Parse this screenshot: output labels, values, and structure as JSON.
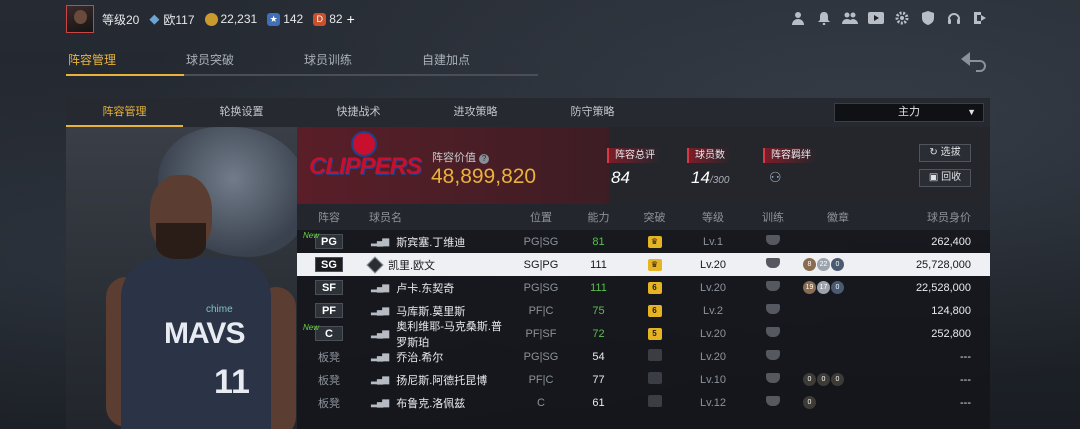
{
  "topbar": {
    "level": "等级20",
    "ou_label": "欧117",
    "coins": "22,231",
    "stars": "142",
    "tickets": "82",
    "plus": "+"
  },
  "main_tabs": [
    "阵容管理",
    "球员突破",
    "球员训练",
    "自建加点"
  ],
  "sub_tabs": [
    "阵容管理",
    "轮换设置",
    "快捷战术",
    "进攻策略",
    "防守策略"
  ],
  "dropdown": {
    "selected": "主力",
    "caret": "▼"
  },
  "team": {
    "logo_text": "CLIPPERS",
    "value_label": "阵容价值",
    "value": "48,899,820",
    "overall_label": "阵容总评",
    "overall": "84",
    "players_label": "球员数",
    "players": "14",
    "players_max": "/300",
    "chem_label": "阵容羁绊",
    "btn_pick": "选拔",
    "btn_recycle": "回收"
  },
  "jersey": {
    "team_text": "MAVS",
    "number": "11",
    "sponsor": "chime"
  },
  "table": {
    "headers": [
      "阵容",
      "球员名",
      "位置",
      "能力",
      "突破",
      "等级",
      "训练",
      "徽章",
      "球员身价"
    ],
    "rows": [
      {
        "pos": "PG",
        "name": "斯宾塞.丁维迪",
        "role": "PG|SG",
        "rating": "81",
        "rating_green": true,
        "brk": "on",
        "level": "Lv.1",
        "badges": [],
        "value": "262,400",
        "new": "New",
        "bench": false
      },
      {
        "pos": "SG",
        "name": "凯里.欧文",
        "role": "SG|PG",
        "rating": "111",
        "rating_green": false,
        "brk": "on",
        "level": "Lv.20",
        "badges": [
          "8",
          "22",
          "0"
        ],
        "value": "25,728,000",
        "new": "",
        "bench": false,
        "selected": true
      },
      {
        "pos": "SF",
        "name": "卢卡.东契奇",
        "role": "PG|SG",
        "rating": "111",
        "rating_green": true,
        "brk": "6",
        "level": "Lv.20",
        "badges": [
          "19",
          "17",
          "0"
        ],
        "value": "22,528,000",
        "new": "",
        "bench": false
      },
      {
        "pos": "PF",
        "name": "马库斯.莫里斯",
        "role": "PF|C",
        "rating": "75",
        "rating_green": true,
        "brk": "6",
        "level": "Lv.2",
        "badges": [],
        "value": "124,800",
        "new": "",
        "bench": false
      },
      {
        "pos": "C",
        "name": "奥利维耶-马克桑斯.普罗斯珀",
        "role": "PF|SF",
        "rating": "72",
        "rating_green": true,
        "brk": "5",
        "level": "Lv.20",
        "badges": [],
        "value": "252,800",
        "new": "New",
        "bench": false
      },
      {
        "pos": "板凳",
        "name": "乔治.希尔",
        "role": "PG|SG",
        "rating": "54",
        "rating_green": false,
        "brk": "off",
        "level": "Lv.20",
        "badges": [],
        "value": "---",
        "new": "",
        "bench": true
      },
      {
        "pos": "板凳",
        "name": "扬尼斯.阿德托昆博",
        "role": "PF|C",
        "rating": "77",
        "rating_green": false,
        "brk": "off",
        "level": "Lv.10",
        "badges": [
          "0",
          "0",
          "0"
        ],
        "value": "---",
        "new": "",
        "bench": true
      },
      {
        "pos": "板凳",
        "name": "布鲁克.洛佩兹",
        "role": "C",
        "rating": "61",
        "rating_green": false,
        "brk": "off",
        "level": "Lv.12",
        "badges": [
          "0"
        ],
        "value": "---",
        "new": "",
        "bench": true
      }
    ]
  }
}
